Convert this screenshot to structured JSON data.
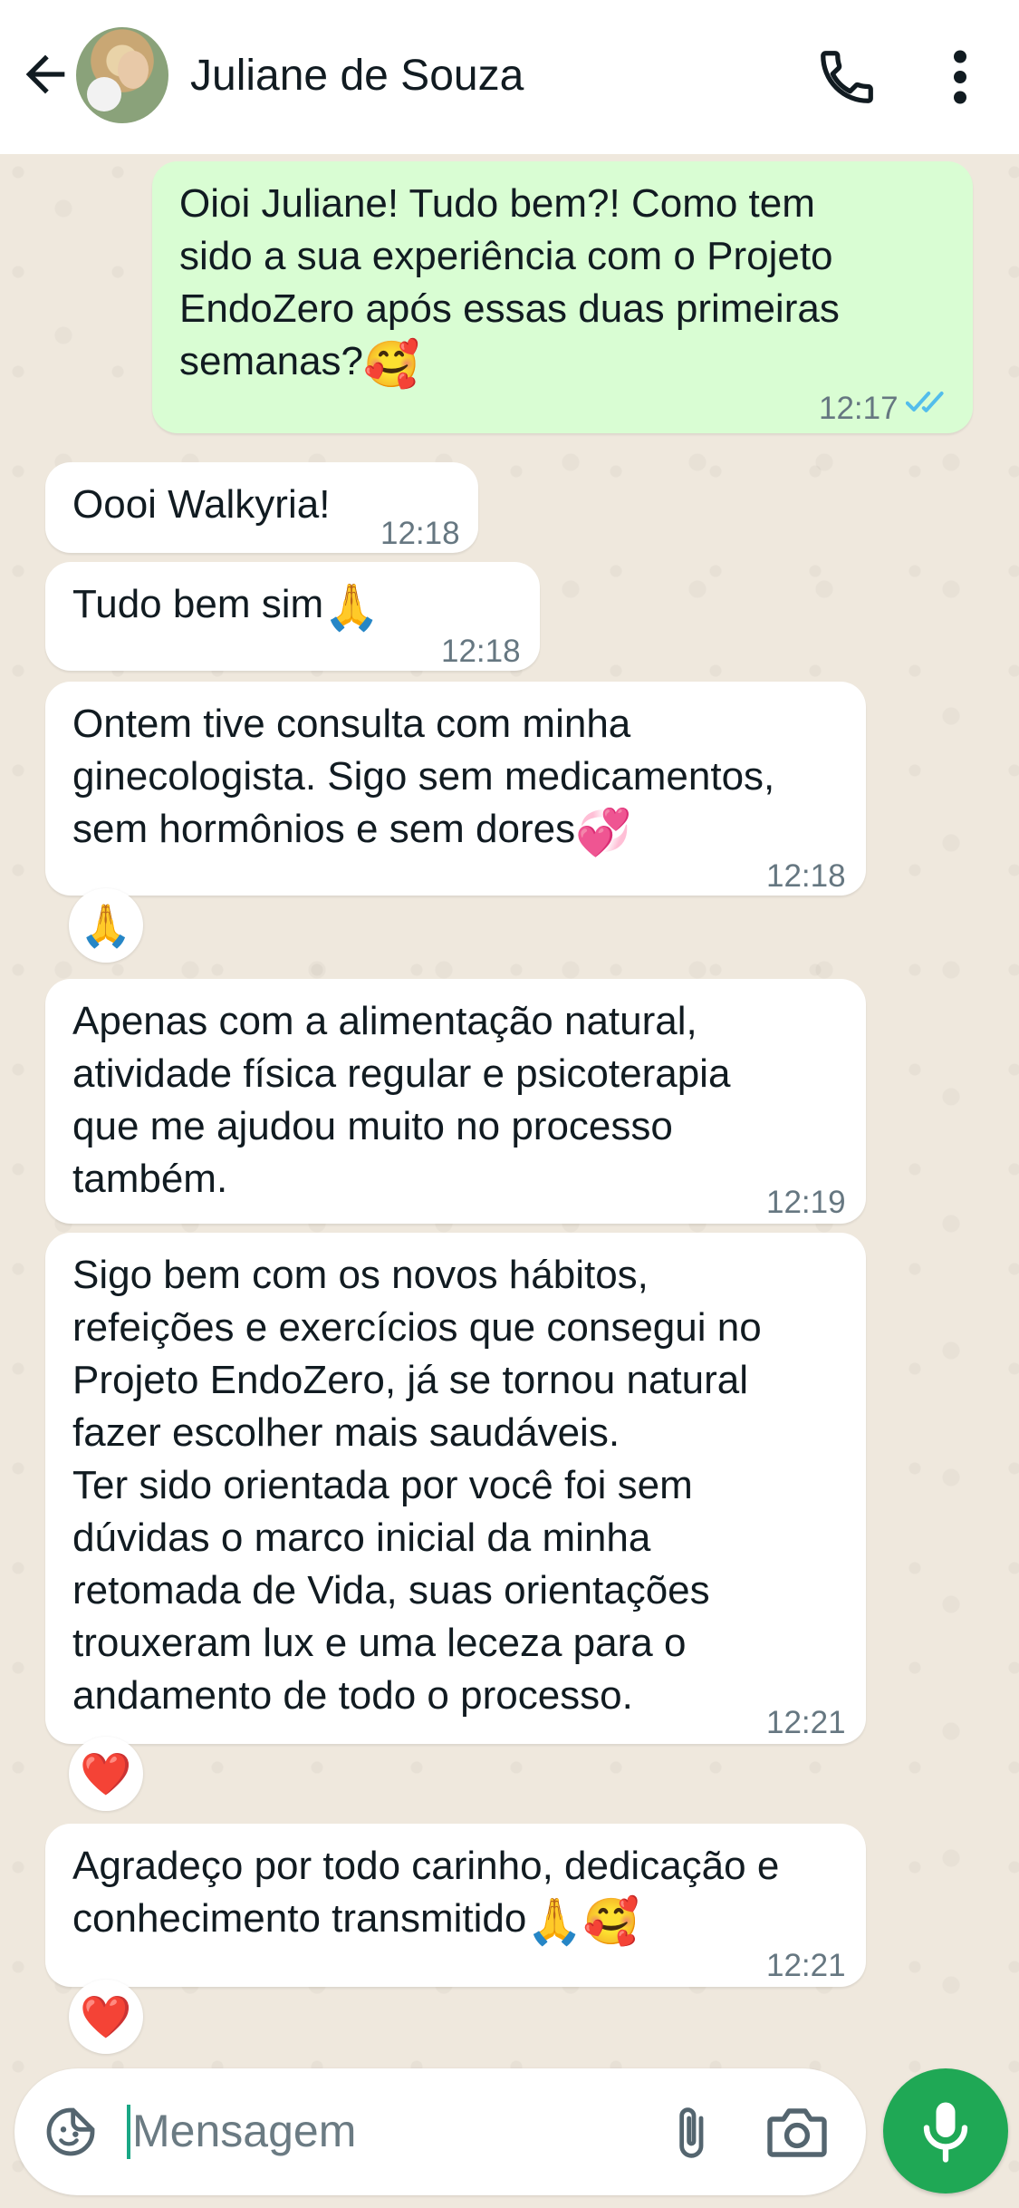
{
  "header": {
    "contact_name": "Juliane de Souza"
  },
  "messages": [
    {
      "direction": "out",
      "text": "Oioi Juliane! Tudo bem?! Como tem\nsido a sua experiência com o Projeto\nEndoZero após essas duas primeiras\nsemanas?",
      "emoji": "🥰",
      "time": "12:17",
      "status": "read"
    },
    {
      "direction": "in",
      "text": "Oooi Walkyria!",
      "time": "12:18"
    },
    {
      "direction": "in",
      "text": "Tudo bem sim",
      "emoji": "🙏",
      "time": "12:18"
    },
    {
      "direction": "in",
      "text": "Ontem tive consulta com minha\nginecologista. Sigo sem medicamentos,\nsem hormônios e sem dores",
      "emoji": "💞",
      "time": "12:18",
      "reaction": "🙏"
    },
    {
      "direction": "in",
      "text": "Apenas com a alimentação natural,\natividade física regular e psicoterapia\nque me ajudou muito no processo\ntambém.",
      "time": "12:19"
    },
    {
      "direction": "in",
      "text": "Sigo bem com os novos hábitos,\nrefeições e exercícios que consegui no\nProjeto EndoZero, já se tornou natural\nfazer escolher mais saudáveis.\nTer sido orientada por você foi sem\ndúvidas o marco inicial da minha\nretomada de Vida, suas orientações\ntrouxeram lux e uma leceza para o\nandamento de todo o processo.",
      "time": "12:21",
      "reaction": "❤️"
    },
    {
      "direction": "in",
      "text": "Agradeço por todo carinho, dedicação e\nconhecimento transmitido",
      "emoji": "🙏🥰",
      "time": "12:21",
      "reaction": "❤️"
    }
  ],
  "composer": {
    "placeholder": "Mensagem"
  },
  "colors": {
    "outgoing_bubble": "#d9fdd3",
    "incoming_bubble": "#ffffff",
    "read_ticks": "#53bdeb",
    "mic_button": "#1fa855"
  },
  "icons": [
    "back-arrow-icon",
    "avatar",
    "phone-icon",
    "more-vert-icon",
    "read-ticks-icon",
    "sticker-icon",
    "attach-icon",
    "camera-icon",
    "mic-icon"
  ]
}
